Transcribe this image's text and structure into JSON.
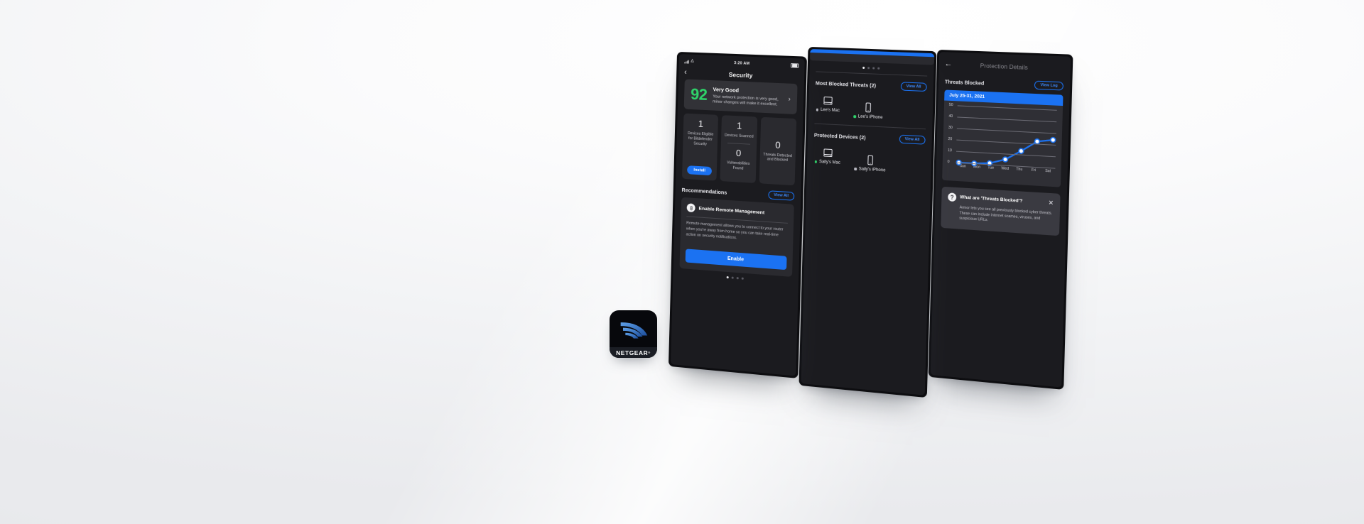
{
  "background": {
    "base_color": "#f1f2f4",
    "accent_blue": "#1b72f2",
    "good_green": "#2fd36a"
  },
  "app_icon": {
    "name": "netgear-app-icon",
    "wordmark": "NETGEAR",
    "trademark": "®"
  },
  "phone1": {
    "status_bar": {
      "time": "3:20 AM",
      "signal": "signal-bars-icon",
      "wifi": "wifi-icon",
      "battery": "battery-icon"
    },
    "nav": {
      "back": "‹",
      "title": "Security"
    },
    "score": {
      "value": "92",
      "rating": "Very Good",
      "description": "Your network protection is very good, minor changes will make it excellent.",
      "chevron": "›"
    },
    "tiles": [
      {
        "number": "1",
        "label": "Devices Eligible for Bitdefender Security",
        "button": "Install"
      },
      {
        "number": "1",
        "label": "Devices Scanned",
        "number2": "0",
        "label2": "Vulnerabilities Found"
      },
      {
        "number": "0",
        "label": "Threats Detected and Blocked"
      }
    ],
    "recommendations": {
      "section_title": "Recommendations",
      "view_all": "View All",
      "card_title": "Enable Remote Management",
      "card_icon": "remote-icon",
      "card_body": "Remote management allows you to connect to your router when you're away from home so you can take real-time action on security notifications.",
      "cta": "Enable"
    },
    "dots": {
      "count": 4,
      "active": 0
    }
  },
  "phone2": {
    "dots": {
      "count": 4,
      "active": 0
    },
    "most_blocked": {
      "title": "Most Blocked Threats (2)",
      "view_all": "View All",
      "devices": [
        {
          "name": "Lee's Mac",
          "icon": "desktop-icon",
          "status_color": "#b9b9c2"
        },
        {
          "name": "Lee's iPhone",
          "icon": "phone-icon",
          "status_color": "#2fd36a"
        }
      ]
    },
    "protected": {
      "title": "Protected Devices (2)",
      "view_all": "View All",
      "devices": [
        {
          "name": "Sally's Mac",
          "icon": "desktop-icon",
          "status_color": "#2fd36a"
        },
        {
          "name": "Sally's iPhone",
          "icon": "phone-icon",
          "status_color": "#b9b9c2"
        }
      ]
    }
  },
  "phone3": {
    "nav": {
      "back": "←",
      "title": "Protection Details"
    },
    "section": {
      "title": "Threats Blocked",
      "view_log": "View Log"
    },
    "chart_data": {
      "type": "line",
      "title": "July 25-31, 2021",
      "categories": [
        "Sun",
        "Mon",
        "Tue",
        "Wed",
        "Thu",
        "Fri",
        "Sat"
      ],
      "values": [
        0,
        0,
        1,
        5,
        13,
        22,
        24
      ],
      "ylabel": "",
      "xlabel": "",
      "ylim": [
        0,
        50
      ],
      "yticks": [
        0,
        10,
        20,
        30,
        40,
        50
      ],
      "grid": true,
      "legend": "none",
      "series_color": "#1b72f2",
      "marker_color": "#ffffff"
    },
    "help": {
      "icon": "question-icon",
      "title": "What are 'Threats Blocked'?",
      "body": "Armor lets you see all previously blocked cyber threats. These can include internet scames, viruses, and suspicious URLs.",
      "close": "✕"
    }
  }
}
